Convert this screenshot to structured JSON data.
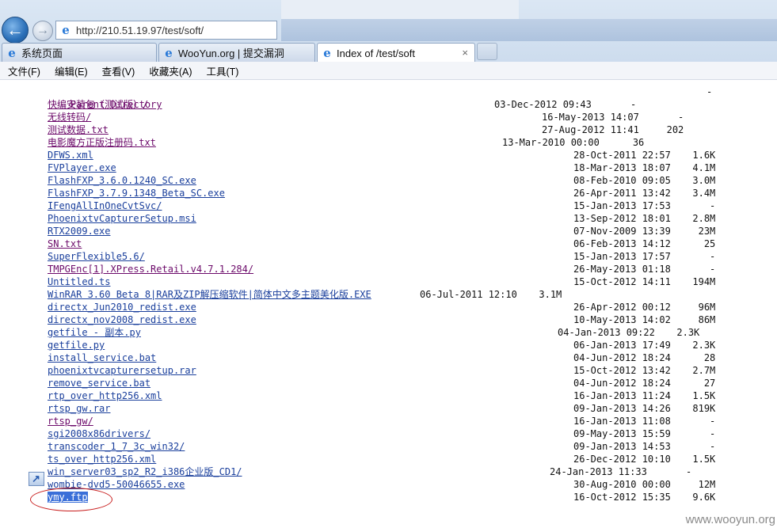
{
  "browser": {
    "url": "http://210.51.19.97/test/soft/",
    "tabs": [
      {
        "label": "系统页面"
      },
      {
        "label": "WooYun.org | 提交漏洞"
      },
      {
        "label": "Index of /test/soft"
      }
    ],
    "tab_close": "×",
    "menu": [
      "文件(F)",
      "编辑(E)",
      "查看(V)",
      "收藏夹(A)",
      "工具(T)"
    ]
  },
  "listing": {
    "parent": {
      "name": "Parent Directory",
      "size": "-"
    },
    "entries": [
      {
        "name": "快编安装包（测试版）/",
        "date": "03-Dec-2012 09:43",
        "size": "-",
        "visited": true
      },
      {
        "name": "无线转码/",
        "date": "16-May-2013 14:07",
        "size": "-",
        "visited": true
      },
      {
        "name": "测试数据.txt",
        "date": "27-Aug-2012 11:41",
        "size": "202",
        "visited": true
      },
      {
        "name": "电影魔方正版注册码.txt",
        "date": "13-Mar-2010 00:00",
        "size": "36",
        "visited": true
      },
      {
        "name": "DFWS.xml",
        "date": "28-Oct-2011 22:57",
        "size": "1.6K",
        "visited": false
      },
      {
        "name": "FVPlayer.exe",
        "date": "18-Mar-2013 18:07",
        "size": "4.1M",
        "visited": false
      },
      {
        "name": "FlashFXP_3.6.0.1240_SC.exe",
        "date": "08-Feb-2010 09:05",
        "size": "3.0M",
        "visited": false
      },
      {
        "name": "FlashFXP_3.7.9.1348_Beta_SC.exe",
        "date": "26-Apr-2011 13:42",
        "size": "3.4M",
        "visited": false
      },
      {
        "name": "IFengAllInOneCvtSvc/",
        "date": "15-Jan-2013 17:53",
        "size": "-",
        "visited": false
      },
      {
        "name": "PhoenixtvCapturerSetup.msi",
        "date": "13-Sep-2012 18:01",
        "size": "2.8M",
        "visited": false
      },
      {
        "name": "RTX2009.exe",
        "date": "07-Nov-2009 13:39",
        "size": "23M",
        "visited": false
      },
      {
        "name": "SN.txt",
        "date": "06-Feb-2013 14:12",
        "size": "25",
        "visited": true
      },
      {
        "name": "SuperFlexible5.6/",
        "date": "15-Jan-2013 17:57",
        "size": "-",
        "visited": false
      },
      {
        "name": "TMPGEnc[1].XPress.Retail.v4.7.1.284/",
        "date": "26-May-2013 01:18",
        "size": "-",
        "visited": true
      },
      {
        "name": "Untitled.ts",
        "date": "15-Oct-2012 14:11",
        "size": "194M",
        "visited": false
      },
      {
        "name": "WinRAR 3.60 Beta 8|RAR及ZIP解压缩软件|简体中文多主题美化版.EXE",
        "date": "06-Jul-2011 12:10",
        "size": "3.1M",
        "visited": false
      },
      {
        "name": "directx_Jun2010_redist.exe",
        "date": "26-Apr-2012 00:12",
        "size": "96M",
        "visited": false
      },
      {
        "name": "directx_nov2008_redist.exe",
        "date": "10-May-2013 14:02",
        "size": "86M",
        "visited": false
      },
      {
        "name": "getfile - 副本.py",
        "date": "04-Jan-2013 09:22",
        "size": "2.3K",
        "visited": false
      },
      {
        "name": "getfile.py",
        "date": "06-Jan-2013 17:49",
        "size": "2.3K",
        "visited": false
      },
      {
        "name": "install_service.bat",
        "date": "04-Jun-2012 18:24",
        "size": "28",
        "visited": false
      },
      {
        "name": "phoenixtvcapturersetup.rar",
        "date": "15-Oct-2012 13:42",
        "size": "2.7M",
        "visited": false
      },
      {
        "name": "remove_service.bat",
        "date": "04-Jun-2012 18:24",
        "size": "27",
        "visited": false
      },
      {
        "name": "rtp_over_http256.xml",
        "date": "16-Jan-2013 11:24",
        "size": "1.5K",
        "visited": false
      },
      {
        "name": "rtsp_gw.rar",
        "date": "09-Jan-2013 14:26",
        "size": "819K",
        "visited": false
      },
      {
        "name": "rtsp_gw/",
        "date": "16-Jan-2013 11:08",
        "size": "-",
        "visited": true
      },
      {
        "name": "sgi2008x86drivers/",
        "date": "09-May-2013 15:59",
        "size": "-",
        "visited": false
      },
      {
        "name": "transcoder_1_7_3c_win32/",
        "date": "09-Jan-2013 14:53",
        "size": "-",
        "visited": false
      },
      {
        "name": "ts_over_http256.xml",
        "date": "26-Dec-2012 10:10",
        "size": "1.5K",
        "visited": false
      },
      {
        "name": "win_server03_sp2_R2_i386企业版_CD1/",
        "date": "24-Jan-2013 11:33",
        "size": "-",
        "visited": false
      },
      {
        "name": "wombie-dvd5-50046655.exe",
        "date": "30-Aug-2010 00:00",
        "size": "12M",
        "visited": false
      },
      {
        "name": "ymy.ftp",
        "date": "16-Oct-2012 15:35",
        "size": "9.6K",
        "visited": false,
        "selected": true
      }
    ]
  },
  "watermark": "www.wooyun.org",
  "colors": {
    "link": "#1a3f9c",
    "visited": "#6c0a6a",
    "annotation": "#c81c1c"
  }
}
